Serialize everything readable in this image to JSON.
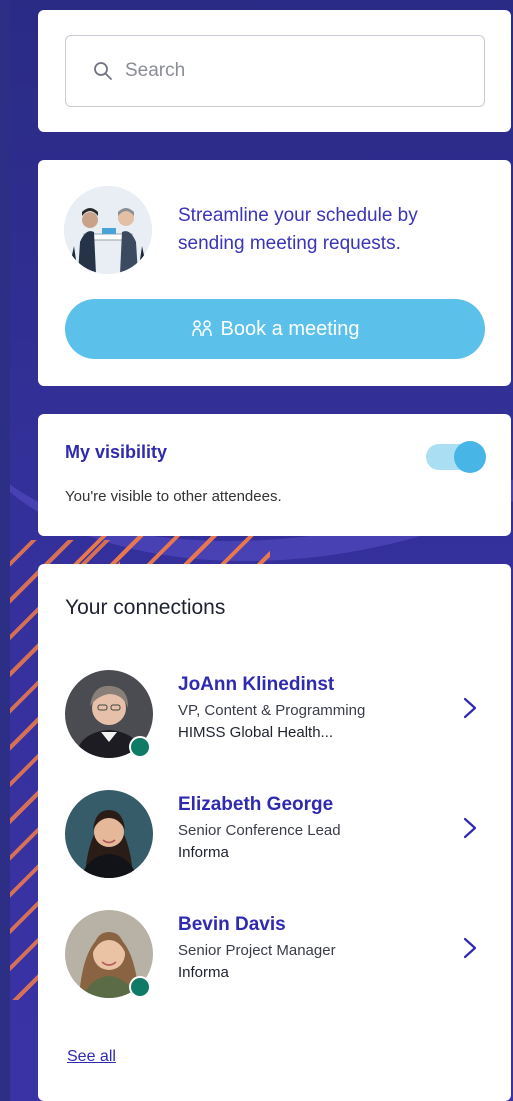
{
  "search": {
    "placeholder": "Search",
    "icon": "search-icon"
  },
  "meeting": {
    "promo_text": "Streamline your schedule by sending meeting requests.",
    "button_label": "Book a meeting",
    "button_icon": "people-icon",
    "button_color": "#5bc1ea"
  },
  "visibility": {
    "title": "My visibility",
    "description": "You're visible to other attendees.",
    "enabled": true
  },
  "connections": {
    "title": "Your connections",
    "items": [
      {
        "name": "JoAnn Klinedinst",
        "role": "VP, Content & Programming",
        "org": "HIMSS Global Health...",
        "online": true
      },
      {
        "name": "Elizabeth George",
        "role": "Senior Conference Lead",
        "org": "Informa",
        "online": false
      },
      {
        "name": "Bevin Davis",
        "role": "Senior Project Manager",
        "org": "Informa",
        "online": true
      }
    ],
    "see_all_label": "See all"
  },
  "colors": {
    "accent": "#2f2bb0",
    "background": "#2d2f86",
    "online": "#0f7a66",
    "stripe": "#e8774d"
  }
}
